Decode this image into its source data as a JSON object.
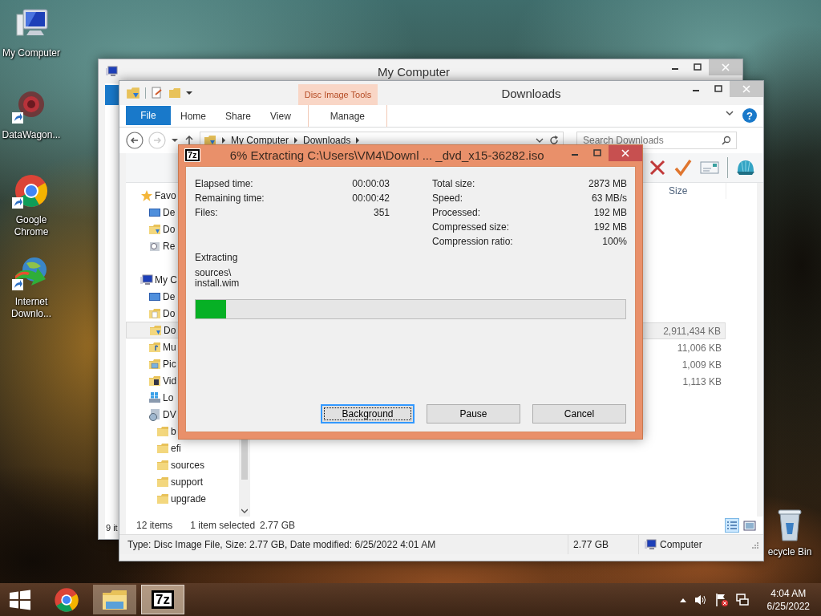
{
  "desktop_icons": [
    {
      "kind": "computer",
      "label": "My Computer",
      "shortcut": false
    },
    {
      "kind": "datawagon",
      "label": "DataWagon...",
      "shortcut": true
    },
    {
      "kind": "chrome",
      "label": "Google Chrome",
      "shortcut": true
    },
    {
      "kind": "idm",
      "label": "Internet Downlo...",
      "shortcut": true
    },
    {
      "kind": "recycle",
      "label": "ecycle Bin",
      "shortcut": false
    }
  ],
  "back_window": {
    "title": "My Computer",
    "status": "9 it"
  },
  "explorer": {
    "title": "Downloads",
    "contextual_group": "Disc Image Tools",
    "tabs": [
      {
        "label": "File",
        "kind": "file"
      },
      {
        "label": "Home",
        "kind": "tab"
      },
      {
        "label": "Share",
        "kind": "tab"
      },
      {
        "label": "View",
        "kind": "tab"
      },
      {
        "label": "Manage",
        "kind": "contextual"
      }
    ],
    "help": "?",
    "address": [
      "My Computer",
      "Downloads"
    ],
    "search": {
      "placeholder": "Search Downloads"
    },
    "nav": [
      {
        "label": "Favo",
        "kind": "favorites",
        "selected": false,
        "children": [
          {
            "label": "De",
            "kind": "desktop",
            "selected": false
          },
          {
            "label": "Do",
            "kind": "downloads",
            "selected": false
          },
          {
            "label": "Re",
            "kind": "recent",
            "selected": false
          }
        ]
      },
      {
        "label": "My C",
        "kind": "computer",
        "selected": false,
        "children": [
          {
            "label": "De",
            "kind": "desktop",
            "selected": false
          },
          {
            "label": "Do",
            "kind": "documents",
            "selected": false
          },
          {
            "label": "Do",
            "kind": "downloads",
            "selected": true
          },
          {
            "label": "Mu",
            "kind": "music",
            "selected": false
          },
          {
            "label": "Pic",
            "kind": "pictures",
            "selected": false
          },
          {
            "label": "Vid",
            "kind": "videos",
            "selected": false
          },
          {
            "label": "Lo",
            "kind": "drive",
            "selected": false
          },
          {
            "label": "DV",
            "kind": "dvd",
            "selected": false,
            "children": [
              {
                "label": "b",
                "kind": "folder",
                "selected": false
              },
              {
                "label": "efi",
                "kind": "folder",
                "selected": false
              },
              {
                "label": "sources",
                "kind": "folder",
                "selected": false
              },
              {
                "label": "support",
                "kind": "folder",
                "selected": false
              },
              {
                "label": "upgrade",
                "kind": "folder",
                "selected": false
              }
            ]
          }
        ]
      }
    ],
    "columns": [
      "Size"
    ],
    "rows": [
      {
        "size": "2,911,434 KB",
        "selected": true
      },
      {
        "size": "11,006 KB",
        "selected": false
      },
      {
        "size": "1,009 KB",
        "selected": false
      },
      {
        "size": "1,113 KB",
        "selected": false
      }
    ],
    "status": {
      "items": "12 items",
      "selection": "1 item selected",
      "selection_size": "2.77 GB"
    },
    "views": [
      {
        "kind": "details",
        "selected": true
      },
      {
        "kind": "thumbnails",
        "selected": false
      }
    ],
    "details": {
      "text": "Type: Disc Image File, Size: 2.77 GB, Date modified: 6/25/2022 4:01 AM",
      "size": "2.77 GB",
      "location": "Computer"
    }
  },
  "dialog": {
    "logo": "7z",
    "title": "6% Extracting C:\\Users\\VM4\\Downl ... _dvd_x15-36282.iso",
    "left_stats": [
      {
        "label": "Elapsed time:",
        "value": "00:00:03"
      },
      {
        "label": "Remaining time:",
        "value": "00:00:42"
      },
      {
        "label": "Files:",
        "value": "351"
      }
    ],
    "right_stats": [
      {
        "label": "Total size:",
        "value": "2873 MB"
      },
      {
        "label": "Speed:",
        "value": "63 MB/s"
      },
      {
        "label": "Processed:",
        "value": "192 MB"
      },
      {
        "label": "Compressed size:",
        "value": "192 MB"
      },
      {
        "label": "Compression ratio:",
        "value": "100%"
      }
    ],
    "status": "Extracting",
    "current_file": [
      "sources\\",
      "install.wim"
    ],
    "progress": {
      "level": 0.07
    },
    "buttons": [
      {
        "label": "Background",
        "default": true
      },
      {
        "label": "Pause",
        "default": false
      },
      {
        "label": "Cancel",
        "default": false
      }
    ]
  },
  "taskbar": {
    "apps": [
      {
        "kind": "chrome",
        "running": false,
        "selected": false
      },
      {
        "kind": "explorer",
        "running": true,
        "selected": false
      },
      {
        "kind": "sevenzip",
        "label": "7z",
        "running": true,
        "selected": true
      }
    ],
    "time": "4:04 AM",
    "date": "6/25/2022"
  }
}
